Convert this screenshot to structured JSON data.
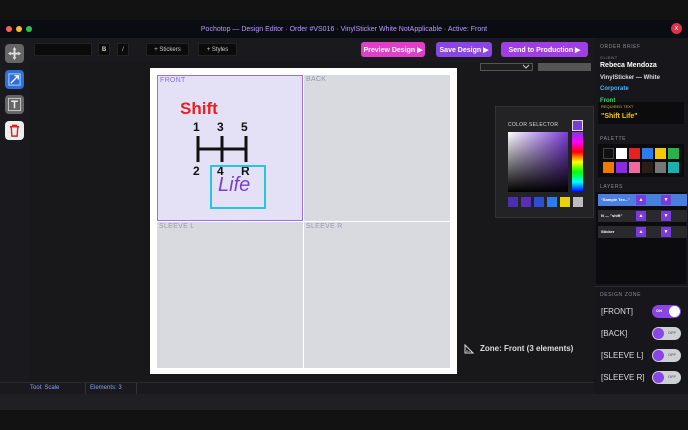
{
  "window": {
    "title": "Pochotop — Design Editor · Order #VS016 · VinylSticker White NotApplicable · Active: Front",
    "close_glyph": "x"
  },
  "toolbar": {
    "bold_label": "B",
    "italic_label": "/",
    "stickers_label": "+ Stickers",
    "styles_label": "+ Styles",
    "preview_label": "Preview Design ▶",
    "save_label": "Save Design ▶",
    "send_label": "Send to Production ▶"
  },
  "canvas": {
    "zones": {
      "front": "FRONT",
      "back": "BACK",
      "sleeve_l": "SLEEVE L",
      "sleeve_r": "SLEEVE R"
    },
    "design": {
      "headline": "Shift",
      "top_gears": [
        "1",
        "3",
        "5"
      ],
      "bottom_gears": [
        "2",
        "4",
        "R"
      ],
      "selected_text": "Life",
      "colors": {
        "headline": "#e8201f",
        "life": "#7b3fc9",
        "selection": "#22c8e0",
        "gate": "#111111"
      }
    },
    "zone_info": "Zone: Front (3 elements)"
  },
  "color_selector": {
    "label": "COLOR SELECTOR",
    "current_hex": "#7b3bd9",
    "recent_colors": [
      "#4a2fb0",
      "#5a2fb8",
      "#2a4fd0",
      "#2a7cf0",
      "#e8d400",
      "#bdbdbd"
    ]
  },
  "status": {
    "tool": "Tool: Scale",
    "elements": "Elements: 3"
  },
  "order_brief": {
    "heading": "ORDER BRIEF",
    "client_label": "CLIENT",
    "client_name": "Rebeca Mendoza",
    "product": "VinylSticker — White",
    "segment": "Corporate",
    "zone": "Front",
    "required_label": "REQUIRED TEXT",
    "required_text": "\"Shift Life\""
  },
  "palette": {
    "heading": "PALETTE",
    "colors": [
      "#111111",
      "#ffffff",
      "#e8201f",
      "#2a7cf0",
      "#f5c800",
      "#27b24a",
      "#f07a00",
      "#8a2be2",
      "#f06aa0",
      "#2a1d16",
      "#777777",
      "#1ab0b0"
    ]
  },
  "layers": {
    "heading": "LAYERS",
    "items": [
      {
        "name": "\"Sample Tex...\"",
        "selected": true
      },
      {
        "name": "N — \"shift\"",
        "selected": false
      },
      {
        "name": "Sticker",
        "selected": false
      }
    ],
    "up_glyph": "▲",
    "down_glyph": "▼"
  },
  "design_zone": {
    "heading": "DESIGN ZONE",
    "zones": [
      {
        "label": "[FRONT]",
        "state": "ON",
        "on": true
      },
      {
        "label": "[BACK]",
        "state": "OFF",
        "on": false
      },
      {
        "label": "[SLEEVE L]",
        "state": "OFF",
        "on": false
      },
      {
        "label": "[SLEEVE R]",
        "state": "OFF",
        "on": false
      }
    ]
  },
  "tool_icons": [
    "move-icon",
    "scale-icon",
    "text-tool-icon",
    "trash-icon"
  ],
  "accent_colors": {
    "purple": "#7b3bd9",
    "pink": "#e040c8",
    "blue": "#7fa0ff"
  }
}
